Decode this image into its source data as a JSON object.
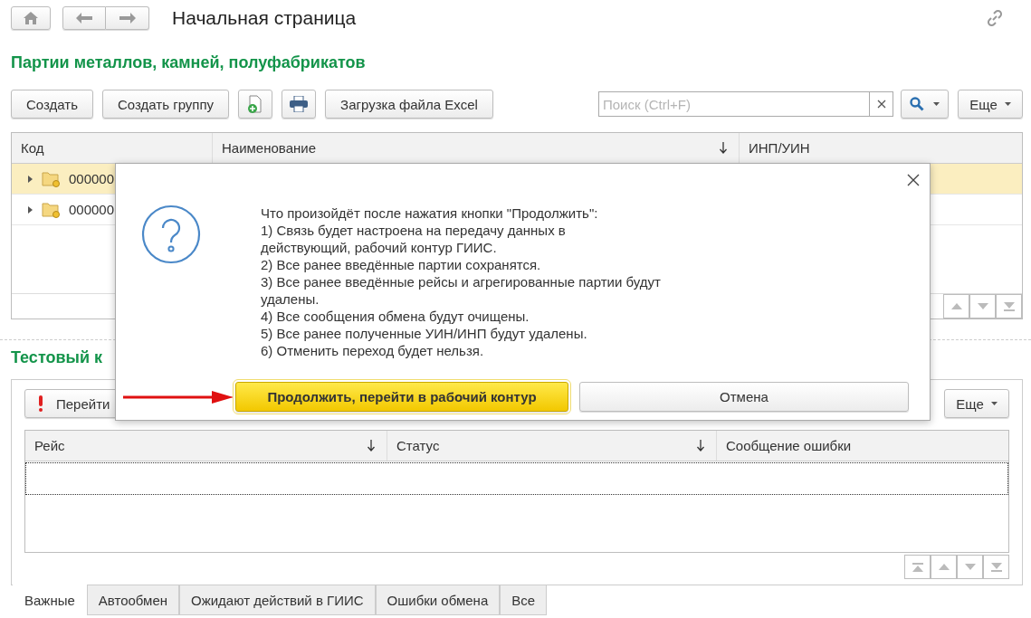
{
  "header": {
    "title": "Начальная страница"
  },
  "section1": {
    "title": "Партии металлов, камней, полуфабрикатов",
    "toolbar": [
      {
        "kind": "text",
        "label": "Создать"
      },
      {
        "kind": "text",
        "label": "Создать группу"
      },
      {
        "kind": "new"
      },
      {
        "kind": "print"
      },
      {
        "kind": "text",
        "label": "Загрузка файла Excel"
      }
    ],
    "search": {
      "placeholder": "Поиск (Ctrl+F)"
    },
    "more": "Еще",
    "columns": [
      {
        "label": "Код",
        "sorted": false
      },
      {
        "label": "Наименование",
        "sorted": true
      },
      {
        "label": "ИНП/УИН",
        "sorted": false
      }
    ],
    "rows": [
      {
        "code": "000000",
        "selected": true
      },
      {
        "code": "000000",
        "selected": false
      }
    ]
  },
  "section2": {
    "title": "Тестовый к",
    "toolbar": [
      {
        "kind": "warning",
        "label": "Перейти"
      }
    ],
    "more": "Еще",
    "columns": [
      {
        "label": "Рейс",
        "sorted": true
      },
      {
        "label": "Статус",
        "sorted": true
      },
      {
        "label": "Сообщение ошибки",
        "sorted": false
      }
    ],
    "tabs": [
      {
        "label": "Важные",
        "selected": true
      },
      {
        "label": "Автообмен",
        "selected": false
      },
      {
        "label": "Ожидают действий в ГИИС",
        "selected": false
      },
      {
        "label": "Ошибки обмена",
        "selected": false
      },
      {
        "label": "Все",
        "selected": false
      }
    ]
  },
  "dialog": {
    "message_lines": [
      "Что произойдёт после нажатия кнопки \"Продолжить\":",
      "1) Связь будет настроена на передачу данных в",
      "действующий, рабочий контур ГИИС.",
      "2) Все ранее введённые партии сохранятся.",
      "3) Все ранее введённые рейсы и агрегированные партии будут",
      "удалены.",
      "4) Все сообщения обмена будут очищены.",
      "5) Все ранее полученные УИН/ИНП будут удалены.",
      "6) Отменить переход будет нельзя."
    ],
    "buttons": [
      {
        "label": "Продолжить, перейти в рабочий контур",
        "default": true
      },
      {
        "label": "Отмена",
        "default": false
      }
    ]
  }
}
